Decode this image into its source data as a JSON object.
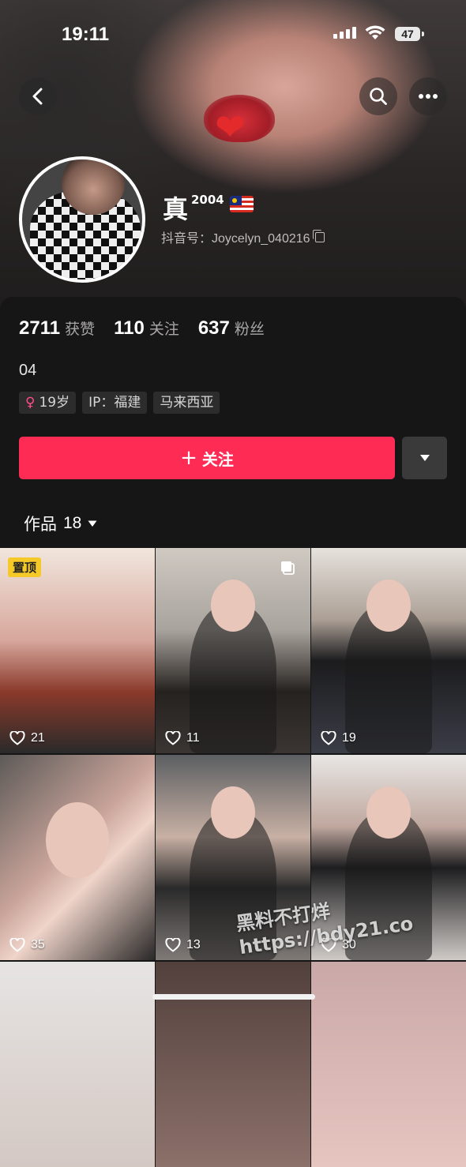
{
  "status_bar": {
    "time": "19:11",
    "battery": "47"
  },
  "profile": {
    "name": "真",
    "name_superscript": "2004",
    "handle": "抖音号：Joycelyn_040216",
    "bio": "04",
    "accent_color": "#fe2c55"
  },
  "stats": [
    {
      "value": "2711",
      "label": "获赞"
    },
    {
      "value": "110",
      "label": "关注"
    },
    {
      "value": "637",
      "label": "粉丝"
    }
  ],
  "tags": {
    "age": "19岁",
    "ip": "IP：福建",
    "location": "马来西亚"
  },
  "actions": {
    "follow_label": "关注",
    "follow_plus": "+"
  },
  "works_tab": {
    "label": "作品",
    "count": "18"
  },
  "grid": {
    "pinned_badge": "置顶",
    "videos": [
      {
        "likes": "21"
      },
      {
        "likes": "11"
      },
      {
        "likes": "19"
      },
      {
        "likes": "35"
      },
      {
        "likes": "13"
      },
      {
        "likes": "30"
      }
    ]
  },
  "watermark": {
    "line1": "黑料不打烊",
    "line2": "https://bdy21.co"
  }
}
